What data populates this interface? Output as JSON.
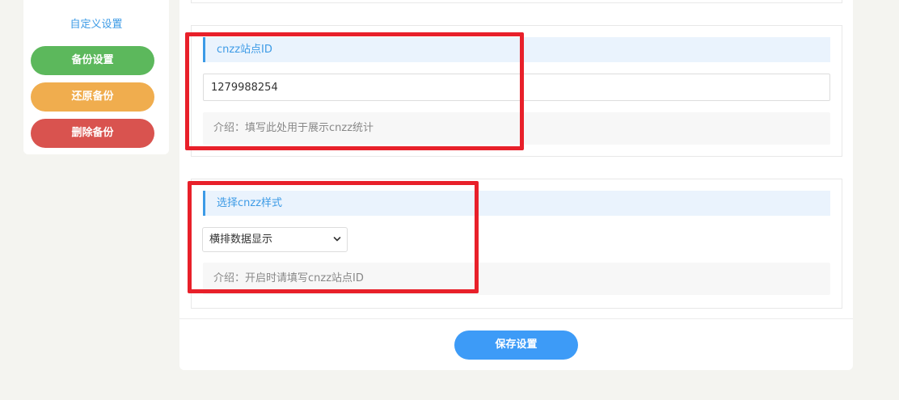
{
  "sidebar": {
    "custom_settings_link": "自定义设置",
    "buttons": [
      {
        "label": "备份设置",
        "color": "#5cb85c"
      },
      {
        "label": "还原备份",
        "color": "#f0ad4e"
      },
      {
        "label": "删除备份",
        "color": "#d9534f"
      }
    ]
  },
  "panels": [
    {
      "title": "cnzz站点ID",
      "input_value": "1279988254",
      "hint": "介绍：填写此处用于展示cnzz统计"
    },
    {
      "title": "选择cnzz样式",
      "select_value": "横排数据显示",
      "hint": "介绍：开启时请填写cnzz站点ID"
    }
  ],
  "footer": {
    "save_label": "保存设置"
  },
  "colors": {
    "accent": "#3d9be6",
    "highlight": "#e8202a",
    "save_button": "#3d9bf7"
  },
  "icons": {
    "select_chevron": "chevron-down-icon"
  }
}
